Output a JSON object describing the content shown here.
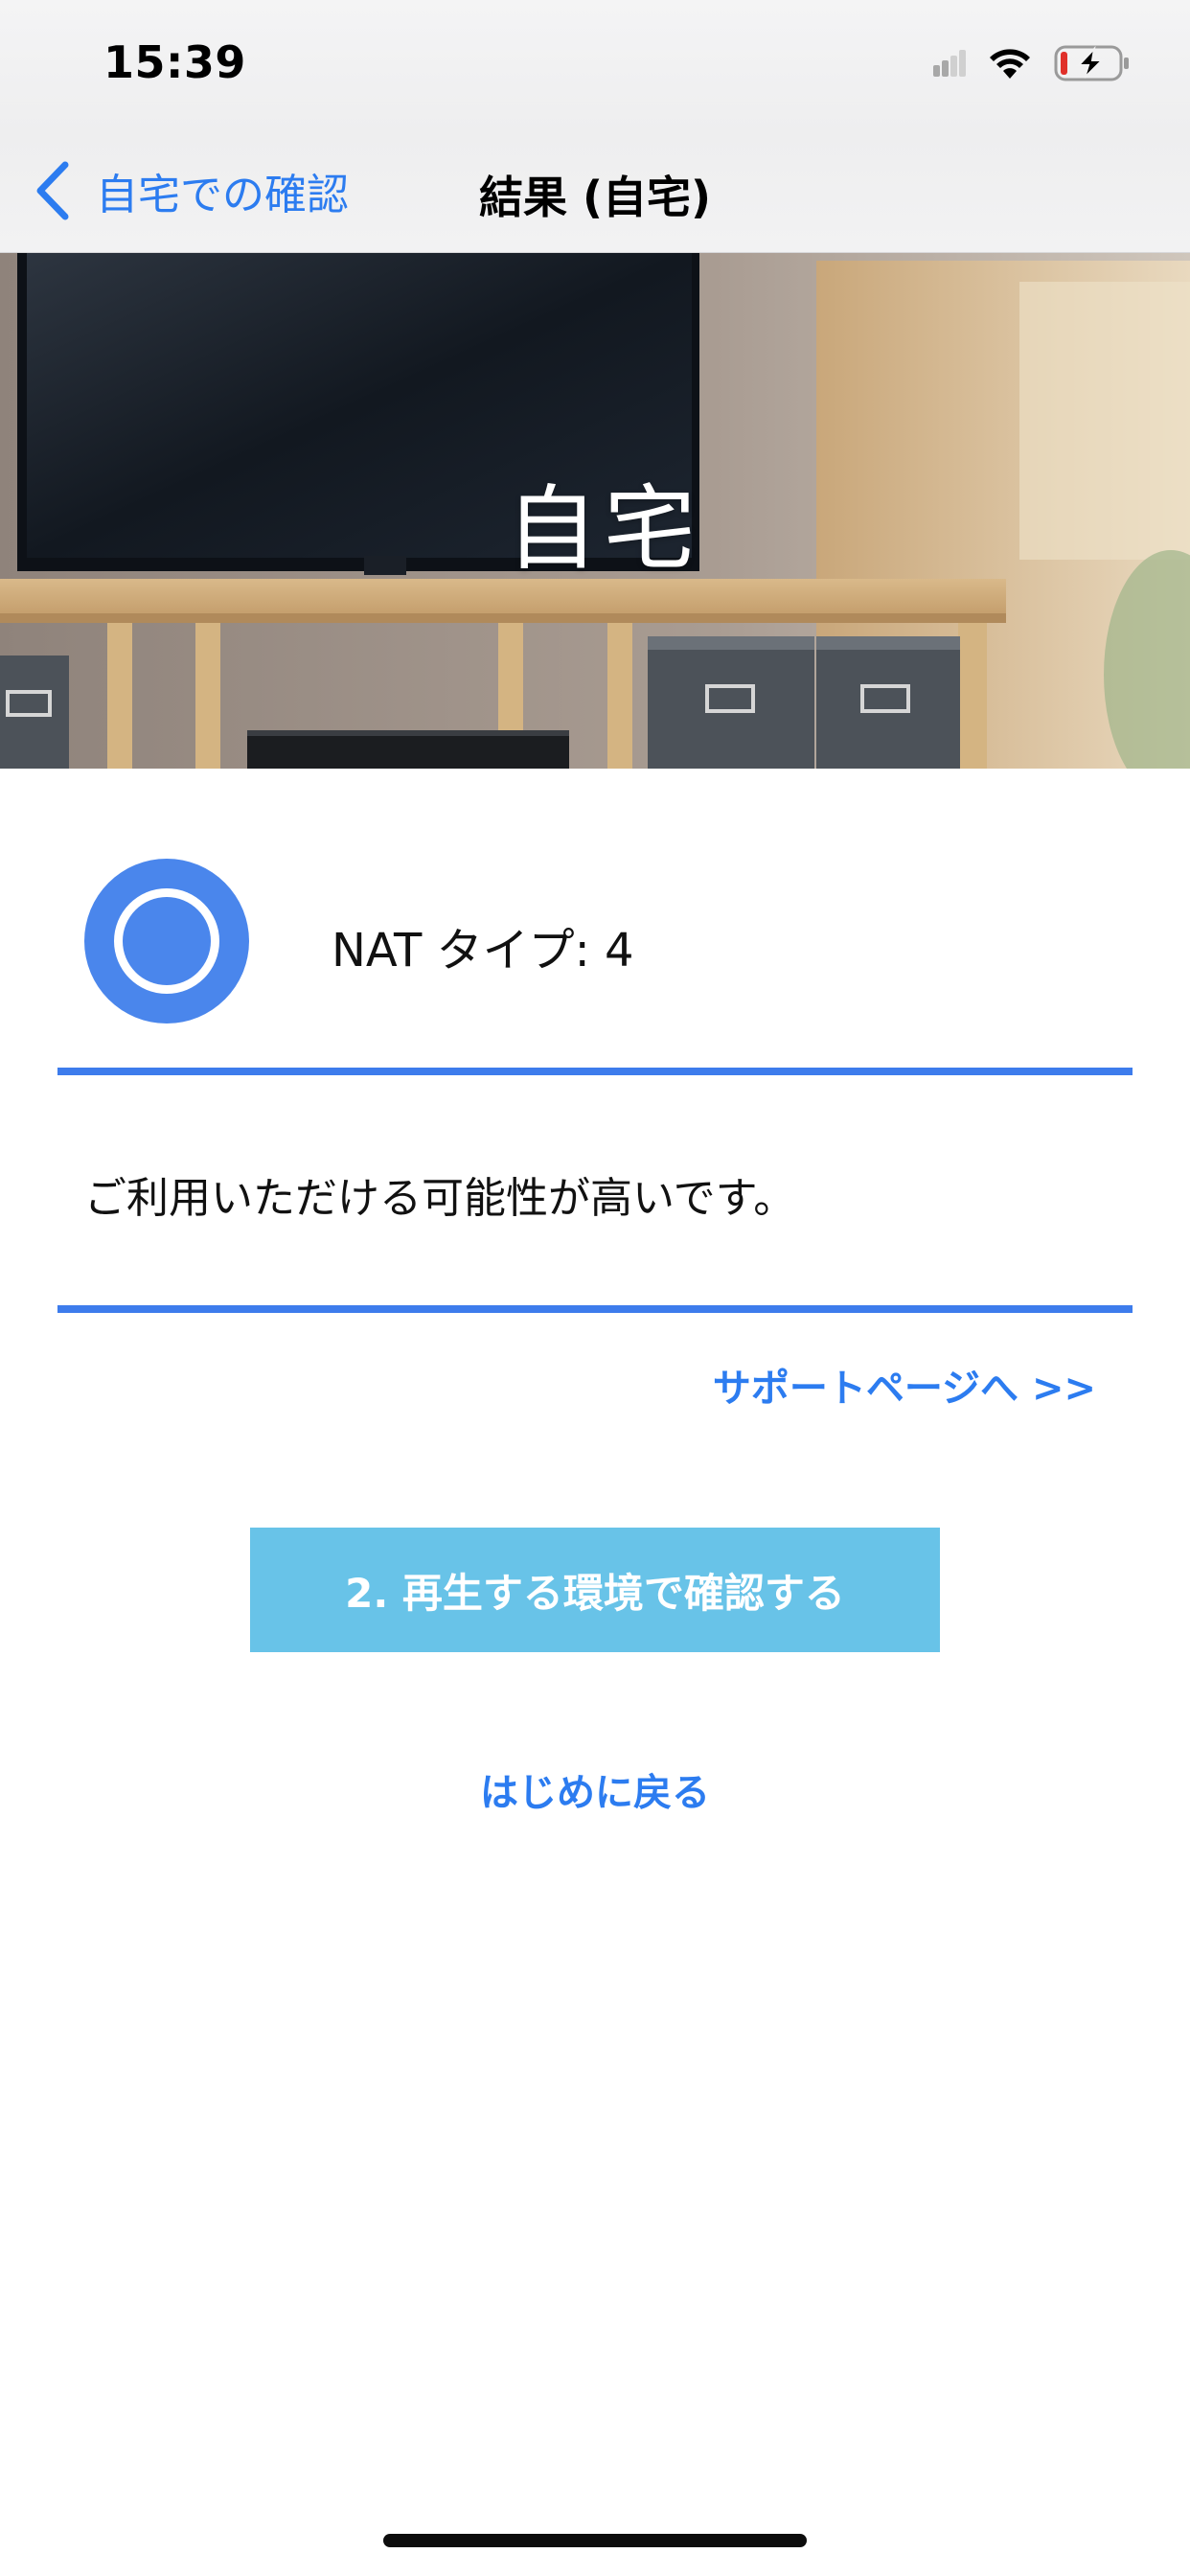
{
  "status_bar": {
    "time": "15:39",
    "icons": [
      "cellular-signal-icon",
      "wifi-icon",
      "battery-charging-icon"
    ]
  },
  "nav": {
    "back_label": "自宅での確認",
    "title": "結果 (自宅)",
    "back_icon": "chevron-left-icon"
  },
  "hero": {
    "title": "自宅",
    "image": "living-room-tv-photo"
  },
  "result": {
    "icon": "double-circle-icon",
    "label": "NAT タイプ: 4",
    "message": "ご利用いただける可能性が高いです。"
  },
  "links": {
    "support": "サポートページへ >>",
    "restart": "はじめに戻る"
  },
  "actions": {
    "next_button": "2. 再生する環境で確認する"
  },
  "colors": {
    "accent": "#2c7cf0",
    "divider": "#3d7cec",
    "result_icon": "#4a86ec",
    "button": "#68c3e8"
  }
}
